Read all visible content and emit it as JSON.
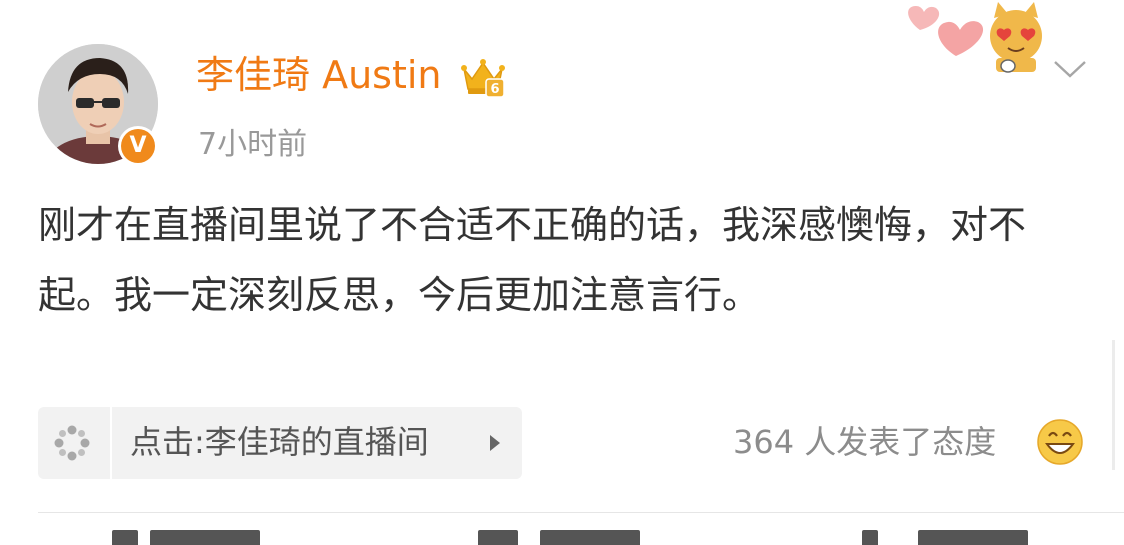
{
  "post": {
    "author": {
      "name": "李佳琦 Austin",
      "level": "6",
      "verified_mark": "V"
    },
    "timestamp": "7小时前",
    "text": "刚才在直播间里说了不合适不正确的话，我深感懊悔，对不起。我一定深刻反思，今后更加注意言行。",
    "live_link": {
      "label": "点击:李佳琦的直播间"
    },
    "attitude": {
      "text": "364 人发表了态度"
    }
  },
  "colors": {
    "username": "#f07a14",
    "verified_badge": "#f08a1c",
    "crown": "#f2b21c",
    "timestamp": "#999999",
    "body_text": "#333333",
    "attitude_text": "#8c8c8c"
  },
  "icons": {
    "crown": "crown-icon",
    "verified": "verified-badge-icon",
    "more": "chevron-down-icon",
    "live_link": "live-broadcast-icon",
    "reaction": "smile-icon"
  }
}
